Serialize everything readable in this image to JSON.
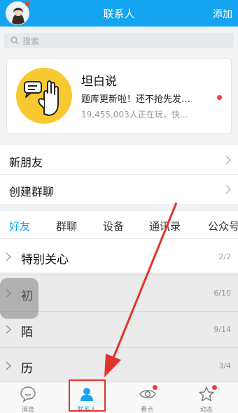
{
  "header": {
    "title": "联系人",
    "add_label": "添加"
  },
  "search": {
    "placeholder": "搜索"
  },
  "promo": {
    "title": "坦白说",
    "desc": "题库更新啦！还不抢先发…",
    "sub": "19,455,003人正在玩，快…"
  },
  "menu": [
    {
      "label": "新朋友"
    },
    {
      "label": "创建群聊"
    }
  ],
  "tabs": [
    "好友",
    "群聊",
    "设备",
    "通讯录",
    "公众号"
  ],
  "groups": [
    {
      "label": "特别关心",
      "count": "2/2"
    },
    {
      "label": "初",
      "count": "6/10"
    },
    {
      "label": "陌",
      "count": "9/14"
    },
    {
      "label": "历",
      "count": "3/4"
    }
  ],
  "nav": [
    {
      "label": "消息",
      "icon": "chat-bubble-icon"
    },
    {
      "label": "联系人",
      "icon": "person-icon"
    },
    {
      "label": "看点",
      "icon": "eye-icon"
    },
    {
      "label": "动态",
      "icon": "star-icon"
    }
  ],
  "colors": {
    "primary": "#14a4f0",
    "badge": "#e8433a",
    "annotation": "#e0352b"
  }
}
